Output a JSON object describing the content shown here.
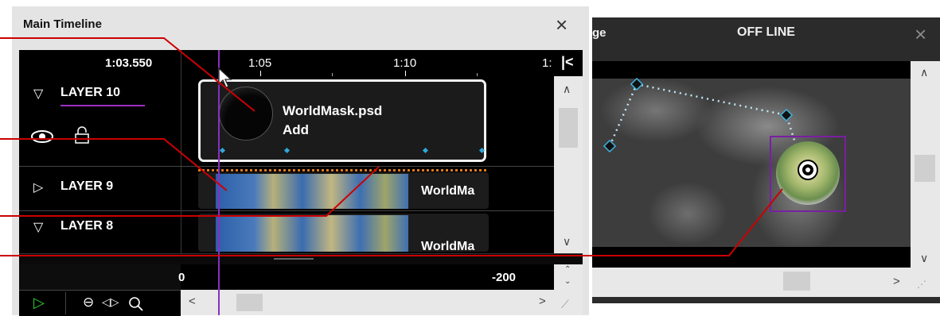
{
  "timeline": {
    "title": "Main Timeline",
    "current_time": "1:03.550",
    "ruler_labels": [
      "1:05",
      "1:10",
      "1:"
    ],
    "bottom_ruler": {
      "left_value": "0",
      "right_value": "-200"
    },
    "layers": [
      {
        "name": "LAYER 10",
        "expanded": true,
        "clip_name": "WorldMask.psd",
        "clip_mode": "Add"
      },
      {
        "name": "LAYER 9",
        "expanded": false,
        "clip_name": "WorldMa"
      },
      {
        "name": "LAYER 8",
        "expanded": true,
        "clip_name": "WorldMa"
      }
    ],
    "icons": {
      "close": "×",
      "collapse": "|<",
      "play": "▷",
      "zoom_out": "⊖",
      "fit": "◁▷",
      "zoom": "🔍",
      "scroll_left": "<",
      "scroll_right": ">"
    }
  },
  "viewer": {
    "title": "OFF LINE",
    "partial_title": "ge",
    "close": "×"
  },
  "colors": {
    "callout": "#cc0000",
    "layer_underline": "#9a2fc4",
    "playhead": "#8a2fc0",
    "keyframe": "#2ea8d8",
    "dotted": "#e07a1c",
    "selection": "#7a1fa2"
  }
}
